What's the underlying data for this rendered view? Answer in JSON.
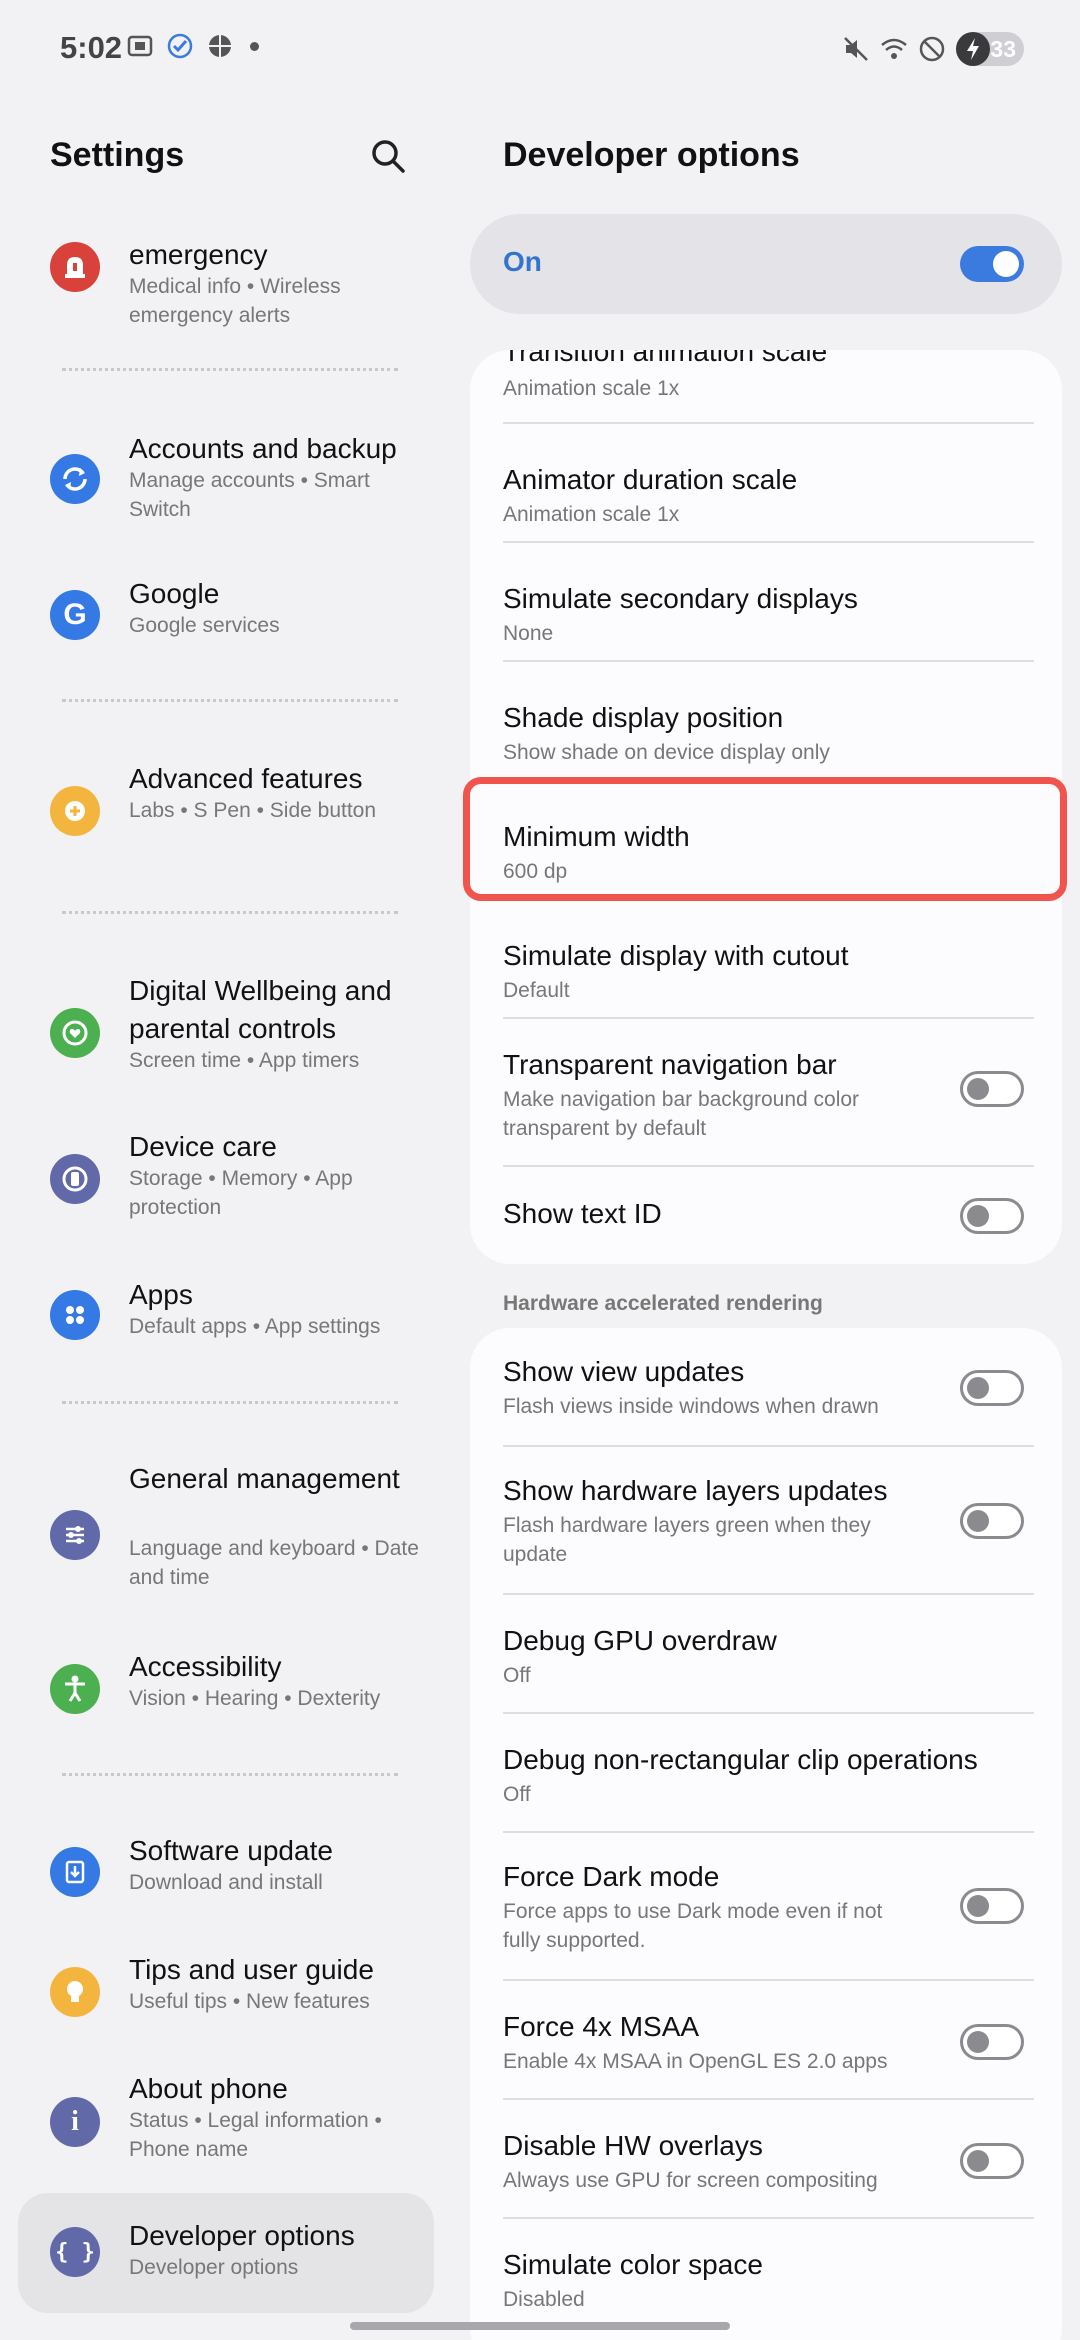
{
  "status_bar": {
    "time": "5:02",
    "battery": "33"
  },
  "left": {
    "title": "Settings",
    "items": [
      {
        "id": "emergency",
        "title": "emergency",
        "subtitle": "Medical info • Wireless emergency alerts",
        "icon": "siren-icon",
        "color": "#d9423b"
      },
      {
        "id": "accounts",
        "title": "Accounts and backup",
        "subtitle": "Manage accounts • Smart Switch",
        "icon": "sync-icon",
        "color": "#3479e4"
      },
      {
        "id": "google",
        "title": "Google",
        "subtitle": "Google services",
        "icon": "google-icon",
        "color": "#3479e4"
      },
      {
        "id": "advanced",
        "title": "Advanced features",
        "subtitle": "Labs • S Pen • Side button",
        "icon": "gear-plus-icon",
        "color": "#f4b53f"
      },
      {
        "id": "wellbeing",
        "title": "Digital Wellbeing and parental controls",
        "subtitle": "Screen time • App timers",
        "icon": "heart-circle-icon",
        "color": "#4caf50"
      },
      {
        "id": "devicecare",
        "title": "Device care",
        "subtitle": "Storage • Memory • App protection",
        "icon": "device-care-icon",
        "color": "#6169a8"
      },
      {
        "id": "apps",
        "title": "Apps",
        "subtitle": "Default apps • App settings",
        "icon": "apps-grid-icon",
        "color": "#3479e4"
      },
      {
        "id": "general",
        "title": "General management",
        "subtitle": "Language and keyboard • Date and time",
        "icon": "sliders-icon",
        "color": "#6169a8"
      },
      {
        "id": "accessibility",
        "title": "Accessibility",
        "subtitle": "Vision • Hearing • Dexterity",
        "icon": "accessibility-icon",
        "color": "#4caf50"
      },
      {
        "id": "software",
        "title": "Software update",
        "subtitle": "Download and install",
        "icon": "download-icon",
        "color": "#3479e4"
      },
      {
        "id": "tips",
        "title": "Tips and user guide",
        "subtitle": "Useful tips • New features",
        "icon": "lightbulb-icon",
        "color": "#f4b53f"
      },
      {
        "id": "about",
        "title": "About phone",
        "subtitle": "Status • Legal information • Phone name",
        "icon": "info-icon",
        "color": "#6169a8"
      },
      {
        "id": "developer",
        "title": "Developer options",
        "subtitle": "Developer options",
        "icon": "braces-icon",
        "color": "#6169a8",
        "selected": true
      }
    ]
  },
  "right": {
    "title": "Developer options",
    "master": {
      "label": "On",
      "state": "on"
    },
    "card1_rows": [
      {
        "title": "Transition animation scale",
        "subtitle": "Animation scale 1x"
      },
      {
        "title": "Animator duration scale",
        "subtitle": "Animation scale 1x"
      },
      {
        "title": "Simulate secondary displays",
        "subtitle": "None"
      },
      {
        "title": "Shade display position",
        "subtitle": "Show shade on device display only"
      },
      {
        "title": "Minimum width",
        "subtitle": "600 dp"
      },
      {
        "title": "Simulate display with cutout",
        "subtitle": "Default"
      },
      {
        "title": "Transparent navigation bar",
        "subtitle": "Make navigation bar background color transparent by default",
        "toggle": "off"
      },
      {
        "title": "Show text ID",
        "subtitle": "",
        "toggle": "off"
      }
    ],
    "section_header": "Hardware accelerated rendering",
    "card2_rows": [
      {
        "title": "Show view updates",
        "subtitle": "Flash views inside windows when drawn",
        "toggle": "off"
      },
      {
        "title": "Show hardware layers updates",
        "subtitle": "Flash hardware layers green when they update",
        "toggle": "off"
      },
      {
        "title": "Debug GPU overdraw",
        "subtitle": "Off"
      },
      {
        "title": "Debug non-rectangular clip operations",
        "subtitle": "Off"
      },
      {
        "title": "Force Dark mode",
        "subtitle": "Force apps to use Dark mode even if not fully supported.",
        "toggle": "off"
      },
      {
        "title": "Force 4x MSAA",
        "subtitle": "Enable 4x MSAA in OpenGL ES 2.0 apps",
        "toggle": "off"
      },
      {
        "title": "Disable HW overlays",
        "subtitle": "Always use GPU for screen compositing",
        "toggle": "off"
      },
      {
        "title": "Simulate color space",
        "subtitle": "Disabled"
      }
    ]
  }
}
